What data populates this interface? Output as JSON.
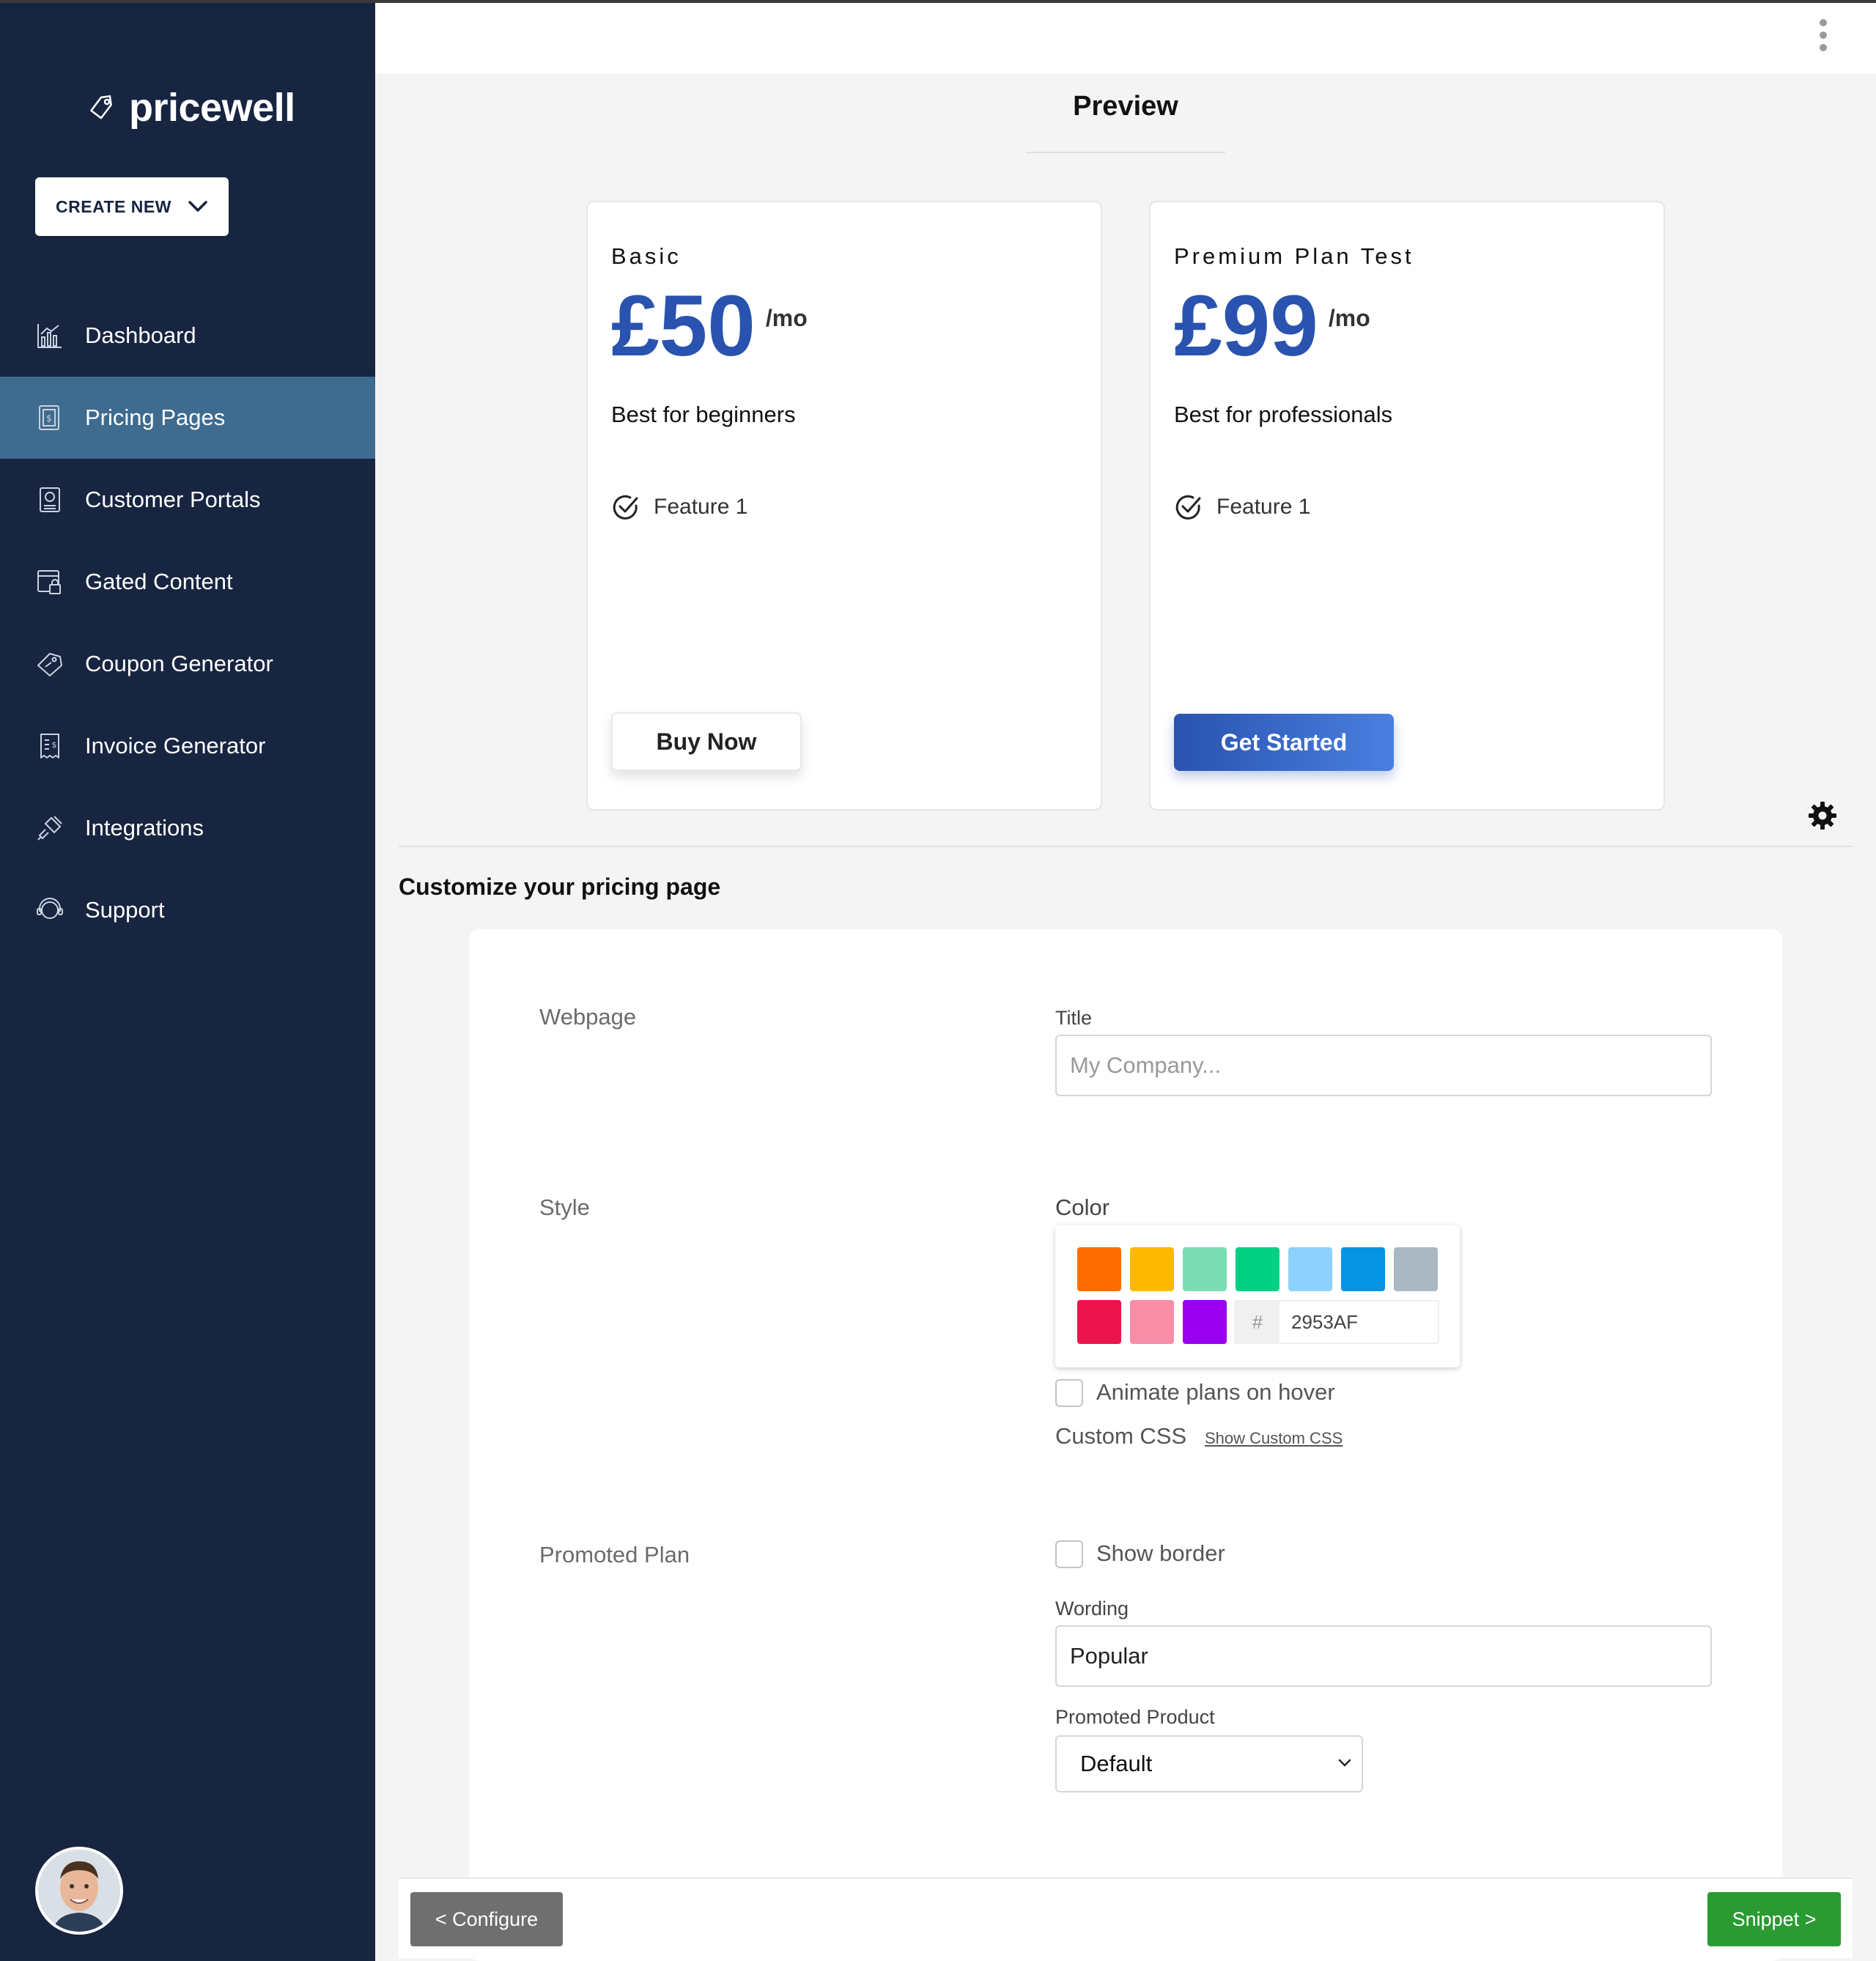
{
  "brand": {
    "name": "pricewell"
  },
  "sidebar": {
    "create_label": "CREATE NEW",
    "items": [
      {
        "label": "Dashboard",
        "icon": "chart-icon"
      },
      {
        "label": "Pricing Pages",
        "icon": "price-list-icon",
        "active": true
      },
      {
        "label": "Customer Portals",
        "icon": "portal-icon"
      },
      {
        "label": "Gated Content",
        "icon": "lock-page-icon"
      },
      {
        "label": "Coupon Generator",
        "icon": "coupon-icon"
      },
      {
        "label": "Invoice Generator",
        "icon": "invoice-icon"
      },
      {
        "label": "Integrations",
        "icon": "plug-icon"
      },
      {
        "label": "Support",
        "icon": "headset-icon"
      }
    ]
  },
  "preview": {
    "title": "Preview",
    "plans": [
      {
        "name": "Basic",
        "price": "£50",
        "period": "/mo",
        "description": "Best for beginners",
        "features": [
          "Feature 1"
        ],
        "button": "Buy Now"
      },
      {
        "name": "Premium Plan Test",
        "price": "£99",
        "period": "/mo",
        "description": "Best for professionals",
        "features": [
          "Feature 1"
        ],
        "button": "Get Started"
      }
    ]
  },
  "customize": {
    "title": "Customize your pricing page",
    "webpage": {
      "section": "Webpage",
      "title_label": "Title",
      "title_placeholder": "My Company...",
      "title_value": ""
    },
    "style": {
      "section": "Style",
      "color_label": "Color",
      "swatches": [
        "#ff6d00",
        "#fcb900",
        "#7bdcb5",
        "#00d084",
        "#8ed1fc",
        "#0693e3",
        "#abb8c3",
        "#eb144c",
        "#f78da7",
        "#9900ef"
      ],
      "hash": "#",
      "hex_value": "2953AF",
      "animate_label": "Animate plans on hover",
      "animate_checked": false,
      "custom_css_label": "Custom CSS",
      "show_css_link": "Show Custom CSS"
    },
    "promoted": {
      "section": "Promoted Plan",
      "show_border_label": "Show border",
      "show_border_checked": false,
      "wording_label": "Wording",
      "wording_value": "Popular",
      "product_label": "Promoted Product",
      "product_value": "Default"
    }
  },
  "footer": {
    "configure_label": "< Configure",
    "snippet_label": "Snippet >"
  },
  "colors": {
    "sidebar": "#172541",
    "active": "#3f6b8f",
    "accent": "#2953af",
    "success": "#2a9a33"
  }
}
